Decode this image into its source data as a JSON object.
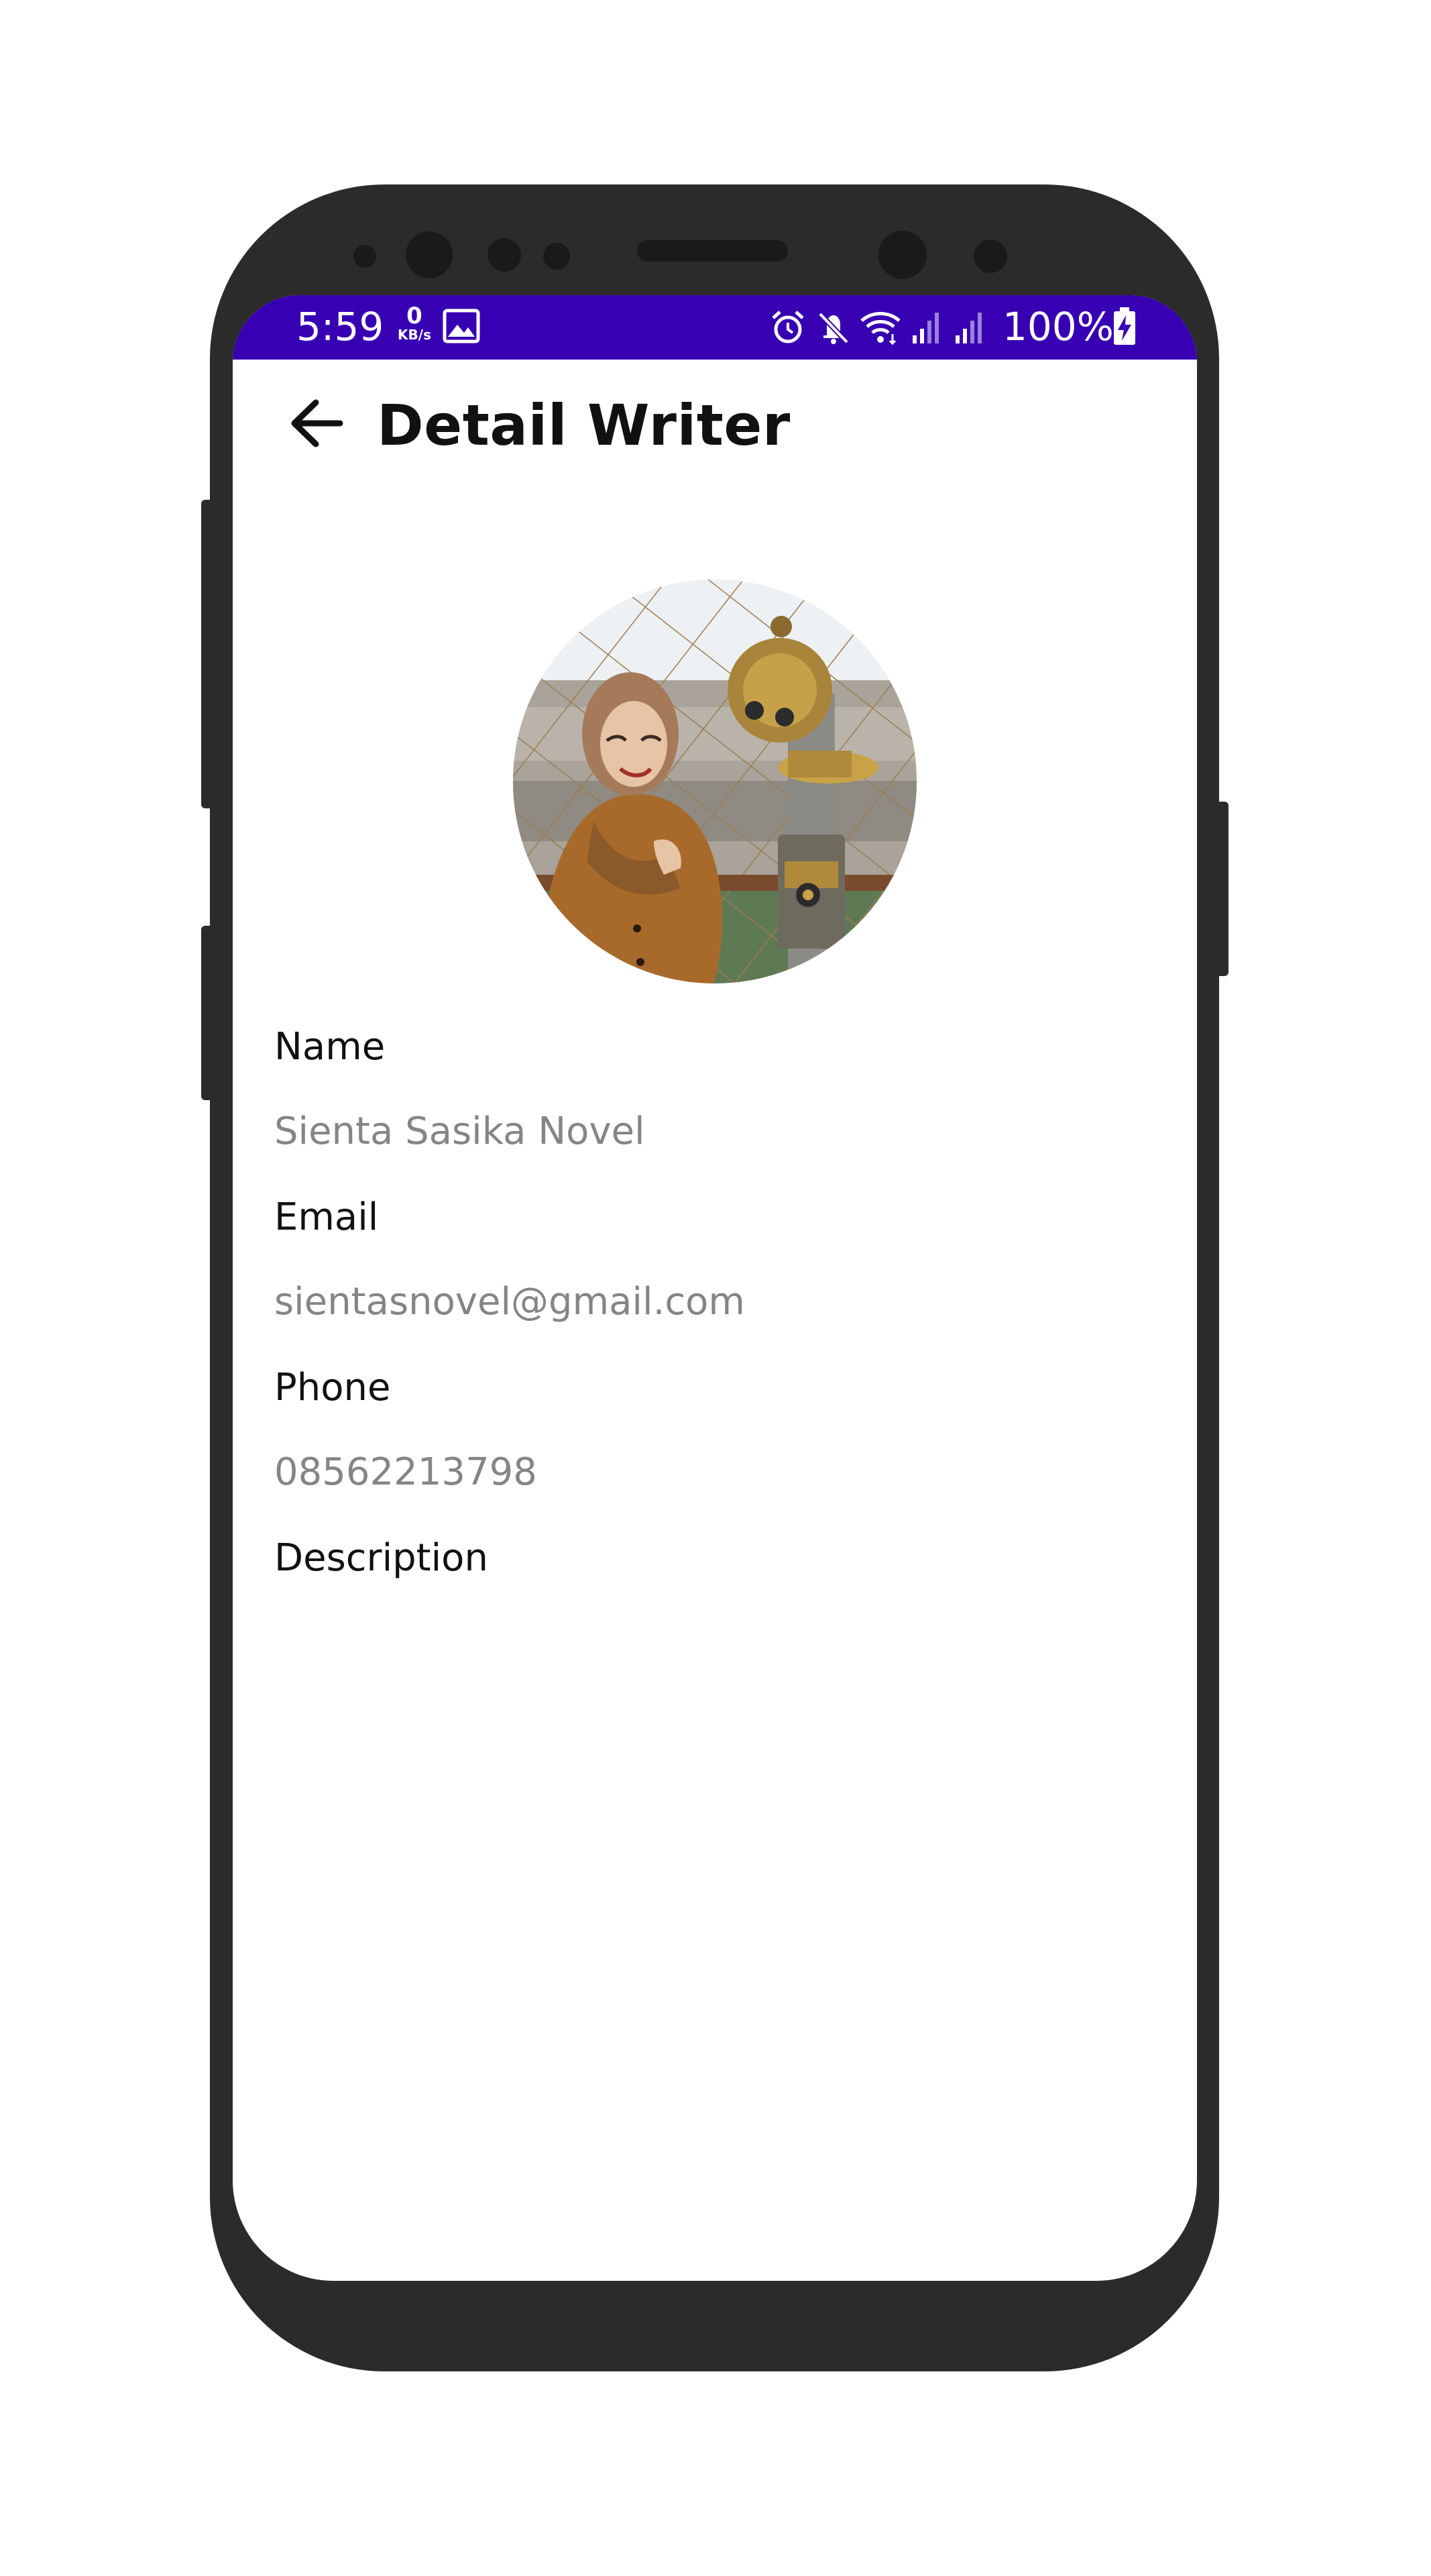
{
  "status_bar": {
    "time": "5:59",
    "net_speed_value": "0",
    "net_speed_unit": "KB/s",
    "battery_percent": "100%",
    "icons": [
      "image-icon",
      "alarm-icon",
      "mute-icon",
      "wifi-icon",
      "signal-icon",
      "signal-icon",
      "battery-charging-icon"
    ],
    "color": "#3700b3"
  },
  "header": {
    "title": "Detail Writer",
    "back_icon": "arrow-left-icon"
  },
  "profile": {
    "avatar": "writer-photo"
  },
  "fields": [
    {
      "label": "Name",
      "value": "Sienta Sasika Novel"
    },
    {
      "label": "Email",
      "value": "sientasnovel@gmail.com"
    },
    {
      "label": "Phone",
      "value": "08562213798"
    },
    {
      "label": "Description",
      "value": ""
    }
  ]
}
